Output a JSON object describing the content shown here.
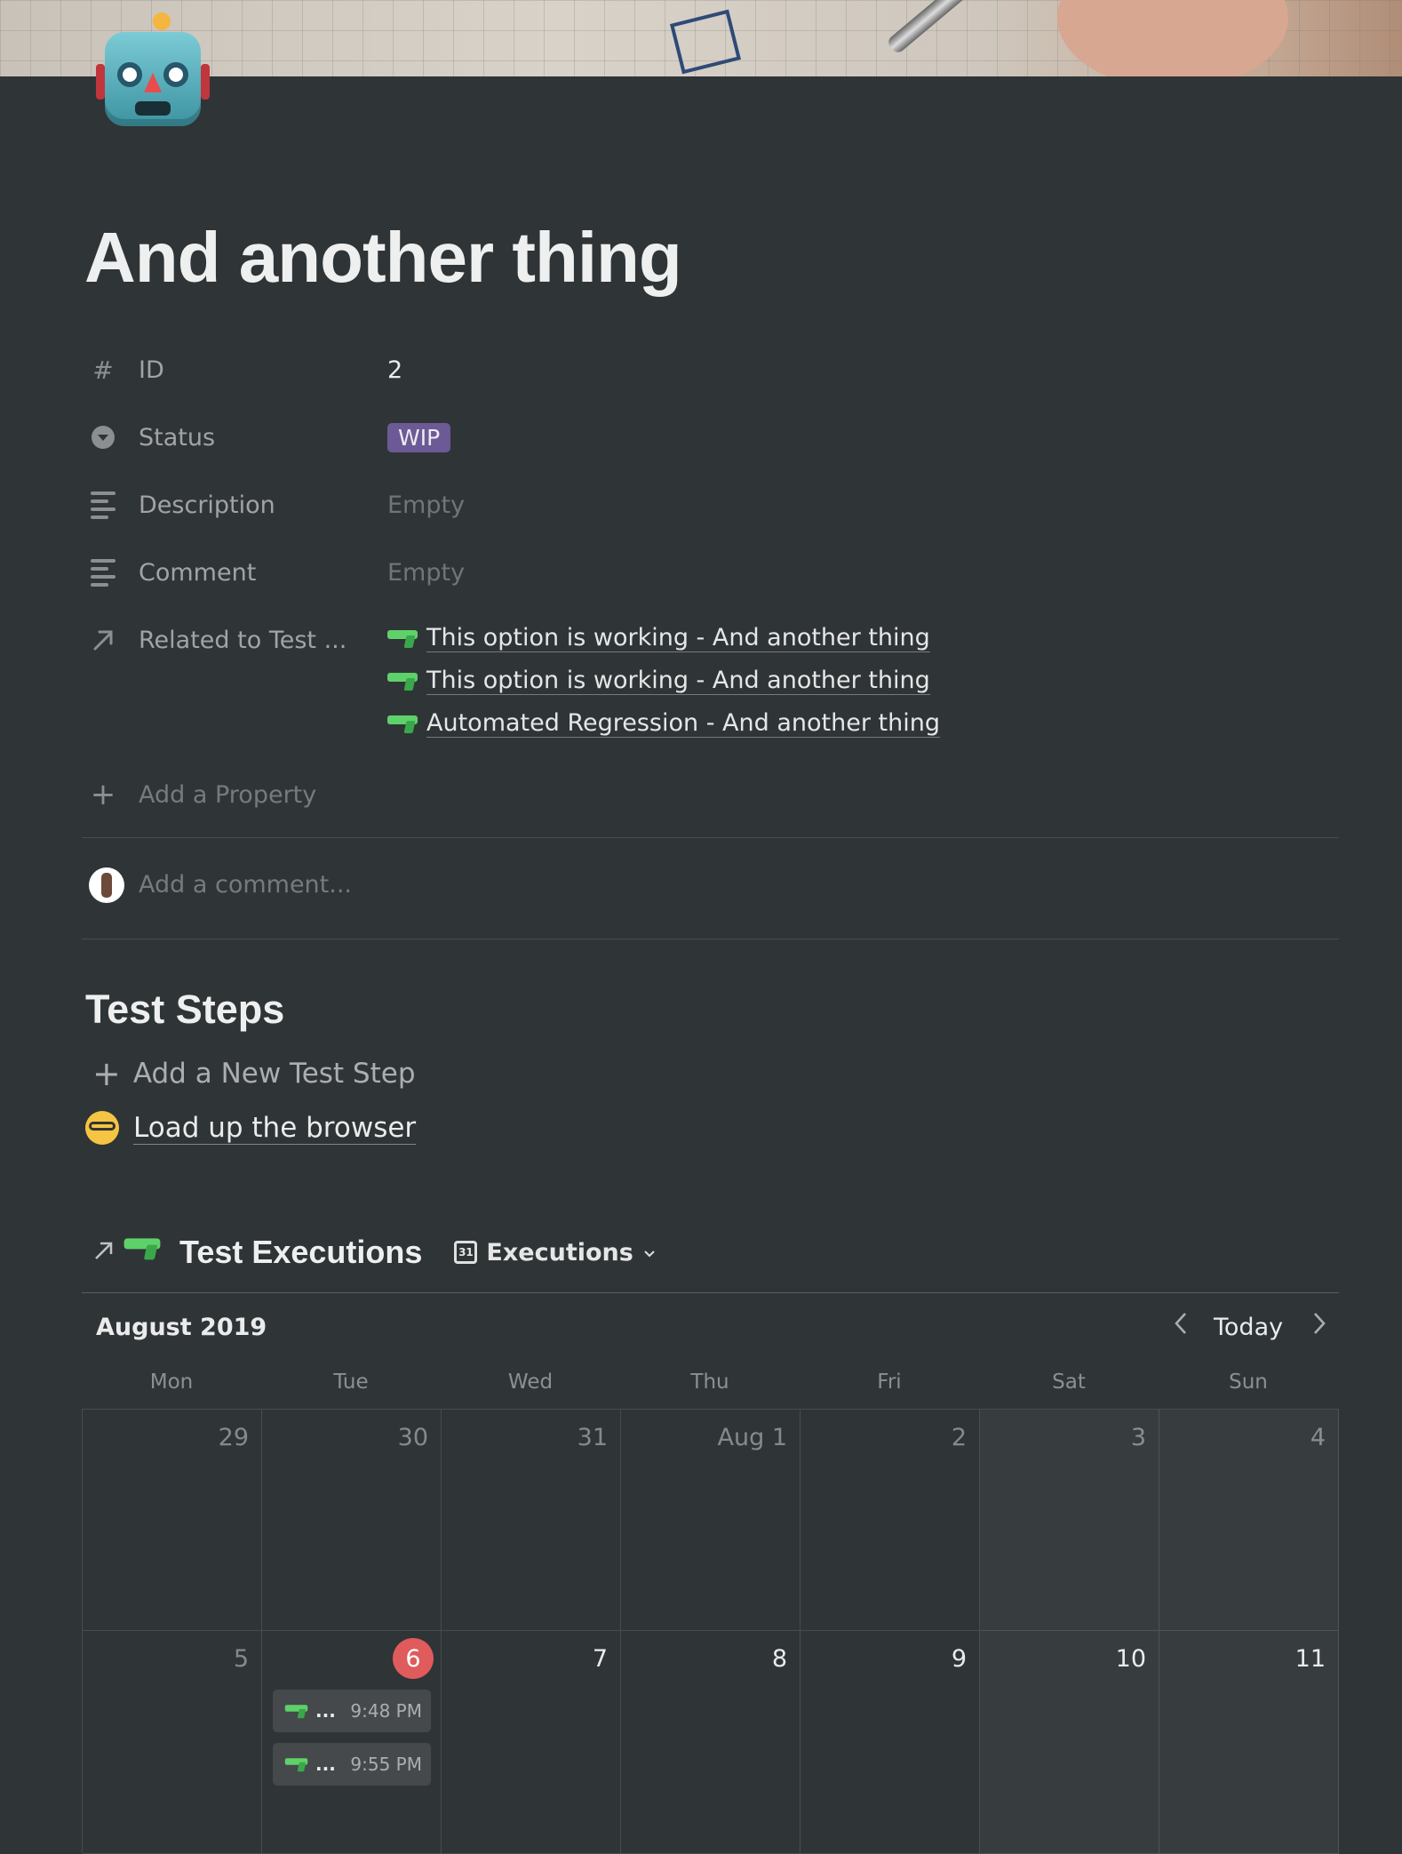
{
  "page": {
    "title": "And another thing"
  },
  "properties": [
    {
      "icon": "hash-icon",
      "label": "ID",
      "value": "2"
    },
    {
      "icon": "status-icon",
      "label": "Status",
      "value": "WIP"
    },
    {
      "icon": "text-lines-icon",
      "label": "Description",
      "value": "Empty"
    },
    {
      "icon": "text-lines-icon",
      "label": "Comment",
      "value": "Empty"
    },
    {
      "icon": "relation-arrow-icon",
      "label": "Related to Test ..."
    }
  ],
  "related": [
    "This option is working - And another thing",
    "This option is working - And another thing",
    "Automated Regression - And another thing"
  ],
  "add_property": "Add a Property",
  "comment_placeholder": "Add a comment...",
  "test_steps": {
    "heading": "Test Steps",
    "add_label": "Add a New Test Step",
    "steps": [
      "Load up the browser"
    ]
  },
  "executions": {
    "title": "Test Executions",
    "view_name": "Executions",
    "month": "August 2019",
    "today_label": "Today",
    "weekdays": [
      "Mon",
      "Tue",
      "Wed",
      "Thu",
      "Fri",
      "Sat",
      "Sun"
    ],
    "weeks": [
      [
        "29",
        "30",
        "31",
        "Aug 1",
        "2",
        "3",
        "4"
      ],
      [
        "5",
        "6",
        "7",
        "8",
        "9",
        "10",
        "11"
      ]
    ],
    "today_day": "6",
    "events": [
      {
        "label": "...",
        "time": "9:48 PM"
      },
      {
        "label": "...",
        "time": "9:55 PM"
      }
    ]
  },
  "colors": {
    "background": "#2f3437",
    "status_tag": "#6c5a96",
    "today_marker": "#e05b5b"
  }
}
